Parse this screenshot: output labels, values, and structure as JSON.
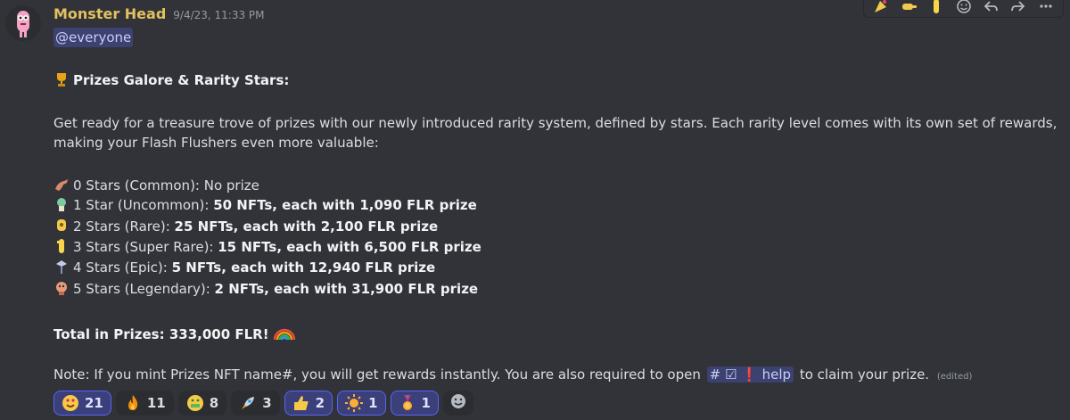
{
  "message": {
    "username": "Monster Head",
    "timestamp": "9/4/23, 11:33 PM",
    "mention": "@everyone",
    "heading": "Prizes Galore & Rarity Stars:",
    "intro_line1": "Get ready for a treasure trove of prizes with our newly introduced rarity system, defined by stars. Each rarity level comes with its own set of rewards,",
    "intro_line2": "making your Flash Flushers even more valuable:",
    "rarities": [
      {
        "label": "0 Stars (Common): No prize",
        "bold": "",
        "icon": "dinosaur-icon"
      },
      {
        "label": "1 Star (Uncommon): ",
        "bold": "50 NFTs, each with 1,090 FLR prize",
        "icon": "monster-uncommon-icon"
      },
      {
        "label": "2 Stars (Rare): ",
        "bold": "25 NFTs, each with 2,100 FLR prize",
        "icon": "monster-rare-icon"
      },
      {
        "label": "3 Stars (Super Rare): ",
        "bold": "15 NFTs, each with 6,500 FLR prize",
        "icon": "monster-super-rare-icon"
      },
      {
        "label": "4 Stars (Epic): ",
        "bold": "5 NFTs, each with 12,940 FLR prize",
        "icon": "monster-epic-icon"
      },
      {
        "label": "5 Stars (Legendary): ",
        "bold": "2 NFTs, each with 31,900 FLR prize",
        "icon": "monster-legendary-icon"
      }
    ],
    "total": "Total in Prizes: 333,000 FLR!",
    "note_before": "Note: If you mint Prizes NFT name#, you will get rewards instantly. You are also required to open",
    "channel": "# ☑ ❗ help",
    "note_after": "to claim your prize.",
    "edited": "(edited)"
  },
  "reactions": [
    {
      "emoji": "heart-eyes-emoji",
      "count": "21",
      "mine": true
    },
    {
      "emoji": "fire-emoji",
      "count": "11",
      "mine": false
    },
    {
      "emoji": "money-mouth-emoji",
      "count": "8",
      "mine": false
    },
    {
      "emoji": "rocket-emoji",
      "count": "3",
      "mine": false
    },
    {
      "emoji": "thumbs-up-emoji",
      "count": "2",
      "mine": true
    },
    {
      "emoji": "sun-emoji",
      "count": "1",
      "mine": true
    },
    {
      "emoji": "medal-emoji",
      "count": "1",
      "mine": true
    }
  ],
  "colors": {
    "background": "#313338",
    "username": "#e2c15f",
    "mention_bg": "#5865f2"
  }
}
